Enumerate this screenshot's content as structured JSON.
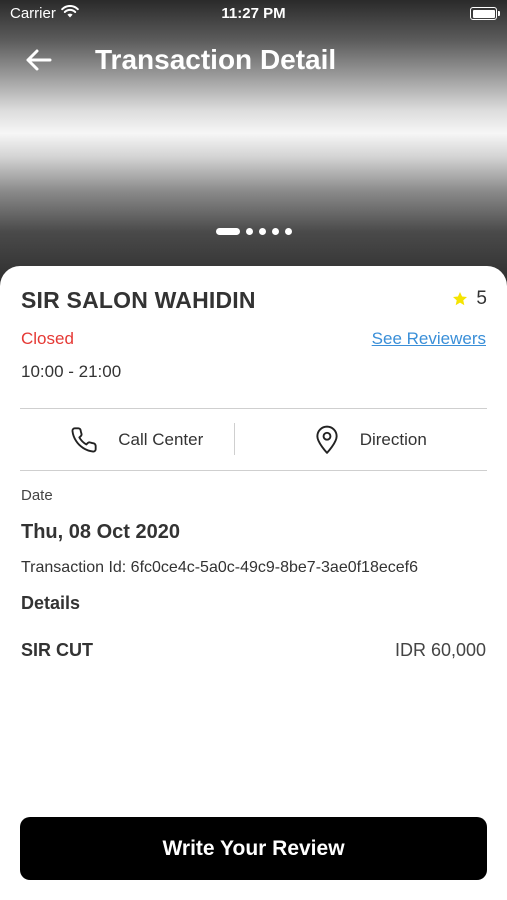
{
  "status_bar": {
    "carrier": "Carrier",
    "time": "11:27 PM"
  },
  "header": {
    "title": "Transaction Detail",
    "back_icon": "arrow-left-icon"
  },
  "carousel": {
    "page_count": 5,
    "active_index": 0
  },
  "shop": {
    "name": "SIR SALON WAHIDIN",
    "rating": "5",
    "star_color": "#f5e400",
    "status": "Closed",
    "status_color": "#e53935",
    "see_reviewers": "See Reviewers",
    "hours": "10:00 - 21:00"
  },
  "actions": {
    "call_center": {
      "label": "Call Center",
      "icon": "phone-icon"
    },
    "direction": {
      "label": "Direction",
      "icon": "map-pin-icon"
    }
  },
  "transaction": {
    "date_label": "Date",
    "date_value": "Thu, 08 Oct 2020",
    "transaction_id": "Transaction Id: 6fc0ce4c-5a0c-49c9-8be7-3ae0f18ecef6",
    "details_label": "Details",
    "items": [
      {
        "name": "SIR CUT",
        "price": "IDR 60,000"
      }
    ]
  },
  "footer": {
    "review_button": "Write Your Review"
  }
}
